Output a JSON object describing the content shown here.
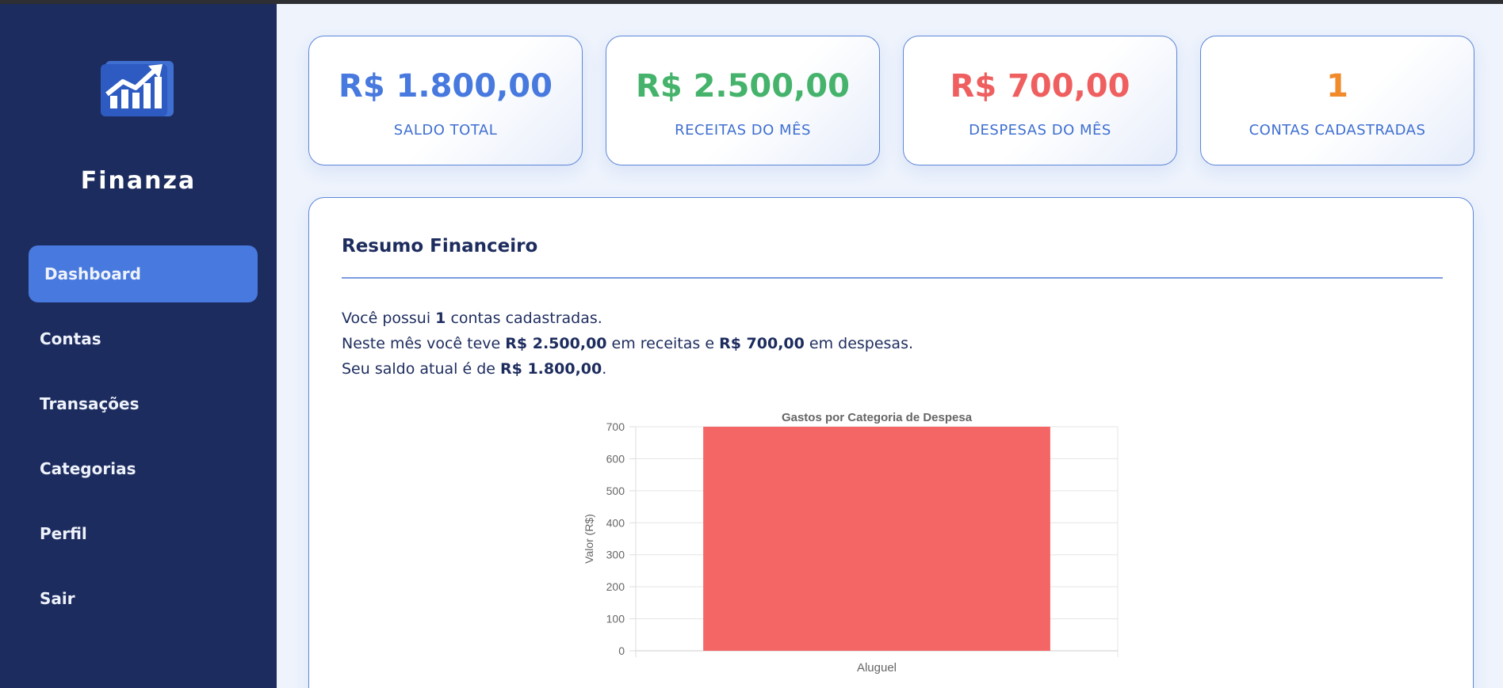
{
  "app": {
    "name": "Finanza"
  },
  "sidebar": {
    "items": [
      {
        "label": "Dashboard",
        "active": true
      },
      {
        "label": "Contas"
      },
      {
        "label": "Transações"
      },
      {
        "label": "Categorias"
      },
      {
        "label": "Perfil"
      },
      {
        "label": "Sair"
      }
    ]
  },
  "cards": [
    {
      "value": "R$ 1.800,00",
      "label": "SALDO TOTAL",
      "color": "#4779de"
    },
    {
      "value": "R$ 2.500,00",
      "label": "RECEITAS DO MÊS",
      "color": "#45b36b"
    },
    {
      "value": "R$ 700,00",
      "label": "DESPESAS DO MÊS",
      "color": "#ef5f5f"
    },
    {
      "value": "1",
      "label": "CONTAS CADASTRADAS",
      "color": "#f08a2a"
    }
  ],
  "summary": {
    "title": "Resumo Financeiro",
    "line1": {
      "pre": "Você possui ",
      "count": "1",
      "post": " contas cadastradas."
    },
    "line2": {
      "pre": "Neste mês você teve ",
      "income": "R$ 2.500,00",
      "mid": " em receitas e ",
      "expense": "R$ 700,00",
      "post": " em despesas."
    },
    "line3": {
      "pre": "Seu saldo atual é de ",
      "balance": "R$ 1.800,00",
      "post": "."
    }
  },
  "colors": {
    "sidebar_bg": "#1d2c5e",
    "accent": "#4779de",
    "bar": "#f46666"
  },
  "chart_data": {
    "type": "bar",
    "title": "Gastos por Categoria de Despesa",
    "ylabel": "Valor (R$)",
    "xlabel": "",
    "categories": [
      "Aluguel"
    ],
    "values": [
      700
    ],
    "ylim": [
      0,
      700
    ],
    "yticks": [
      0,
      100,
      200,
      300,
      400,
      500,
      600,
      700
    ],
    "grid": true,
    "legend": "none"
  }
}
